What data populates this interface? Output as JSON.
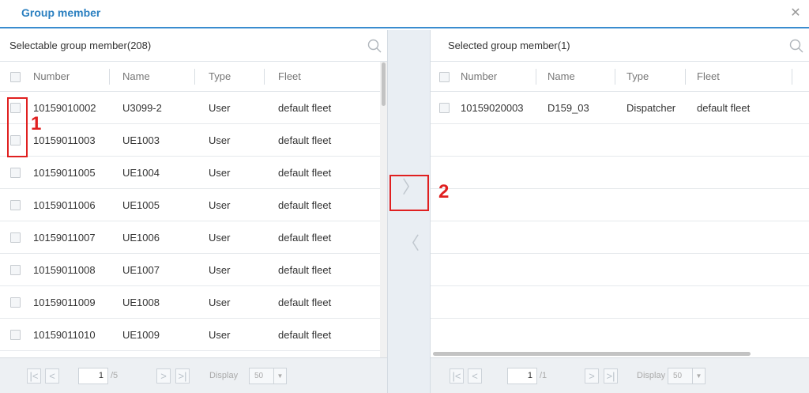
{
  "dialog": {
    "title": "Group member",
    "close_icon": "close-icon"
  },
  "left": {
    "title": "Selectable group member(208)",
    "columns": [
      "Number",
      "Name",
      "Type",
      "Fleet"
    ],
    "rows": [
      {
        "number": "10159010002",
        "name": "U3099-2",
        "type": "User",
        "fleet": "default fleet"
      },
      {
        "number": "10159011003",
        "name": "UE1003",
        "type": "User",
        "fleet": "default fleet"
      },
      {
        "number": "10159011005",
        "name": "UE1004",
        "type": "User",
        "fleet": "default fleet"
      },
      {
        "number": "10159011006",
        "name": "UE1005",
        "type": "User",
        "fleet": "default fleet"
      },
      {
        "number": "10159011007",
        "name": "UE1006",
        "type": "User",
        "fleet": "default fleet"
      },
      {
        "number": "10159011008",
        "name": "UE1007",
        "type": "User",
        "fleet": "default fleet"
      },
      {
        "number": "10159011009",
        "name": "UE1008",
        "type": "User",
        "fleet": "default fleet"
      },
      {
        "number": "10159011010",
        "name": "UE1009",
        "type": "User",
        "fleet": "default fleet"
      }
    ],
    "footer": {
      "page": "1",
      "total": "/5",
      "display_label": "Display",
      "display_value": "50"
    }
  },
  "right": {
    "title": "Selected group member(1)",
    "columns": [
      "Number",
      "Name",
      "Type",
      "Fleet"
    ],
    "rows": [
      {
        "number": "10159020003",
        "name": "D159_03",
        "type": "Dispatcher",
        "fleet": "default fleet"
      }
    ],
    "footer": {
      "page": "1",
      "total": "/1",
      "display_label": "Display",
      "display_value": "50"
    }
  },
  "move": {
    "add_glyph": "〉",
    "remove_glyph": "〈"
  },
  "annotations": {
    "one": "1",
    "two": "2"
  },
  "colors": {
    "accent": "#2a7fc0",
    "annotation": "#e02020"
  }
}
